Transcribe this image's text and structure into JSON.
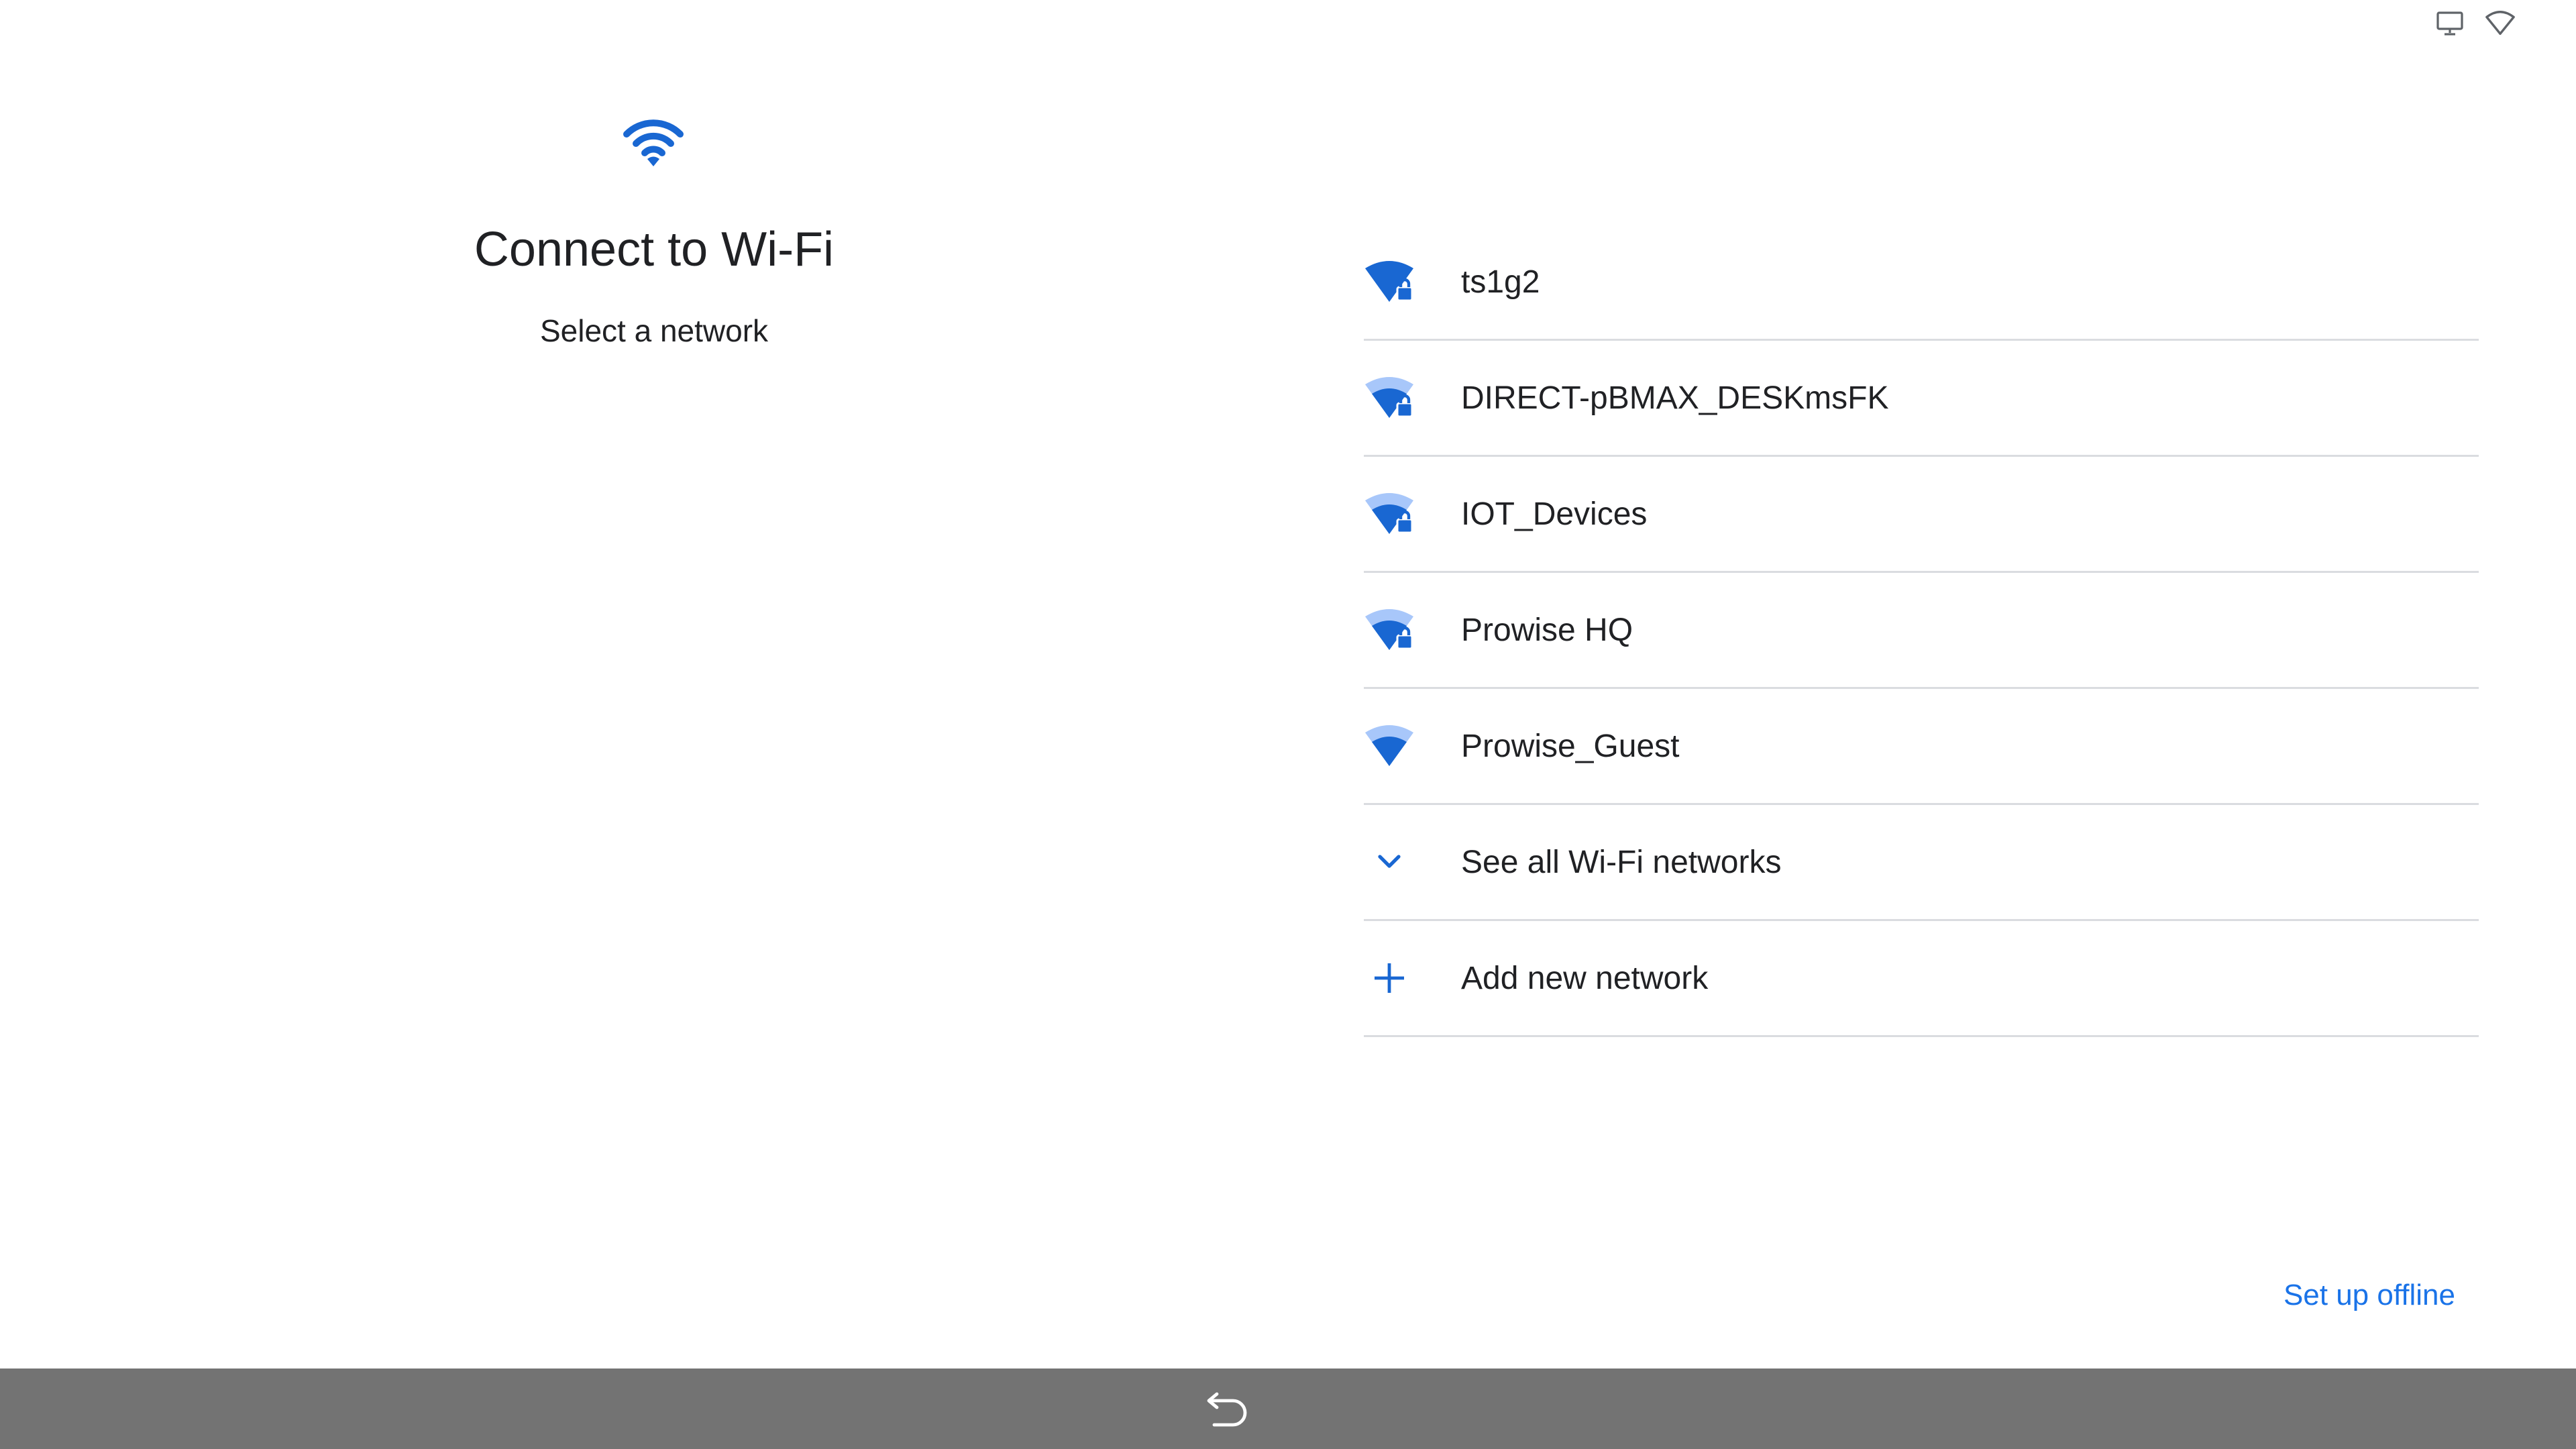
{
  "status_bar": {
    "icons": [
      "cast-screen-icon",
      "wifi-outline-icon"
    ]
  },
  "header": {
    "title": "Connect to Wi-Fi",
    "subtitle": "Select a network",
    "icon": "wifi-icon"
  },
  "networks": [
    {
      "name": "ts1g2",
      "icon": "wifi-locked-icon",
      "signal": "full",
      "secured": true
    },
    {
      "name": "DIRECT-pBMAX_DESKmsFK",
      "icon": "wifi-locked-icon",
      "signal": "medium",
      "secured": true
    },
    {
      "name": "IOT_Devices",
      "icon": "wifi-locked-icon",
      "signal": "medium",
      "secured": true
    },
    {
      "name": "Prowise HQ",
      "icon": "wifi-locked-icon",
      "signal": "medium",
      "secured": true
    },
    {
      "name": "Prowise_Guest",
      "icon": "wifi-icon",
      "signal": "medium",
      "secured": false
    }
  ],
  "actions": {
    "see_all": "See all Wi-Fi networks",
    "add_network": "Add new network"
  },
  "footer": {
    "offline_label": "Set up offline"
  },
  "colors": {
    "accent": "#1a73e8",
    "icon_blue": "#1967d2",
    "icon_light": "#a8c7fa",
    "nav_bar": "#737373",
    "divider": "#dadce0",
    "text": "#202124"
  }
}
